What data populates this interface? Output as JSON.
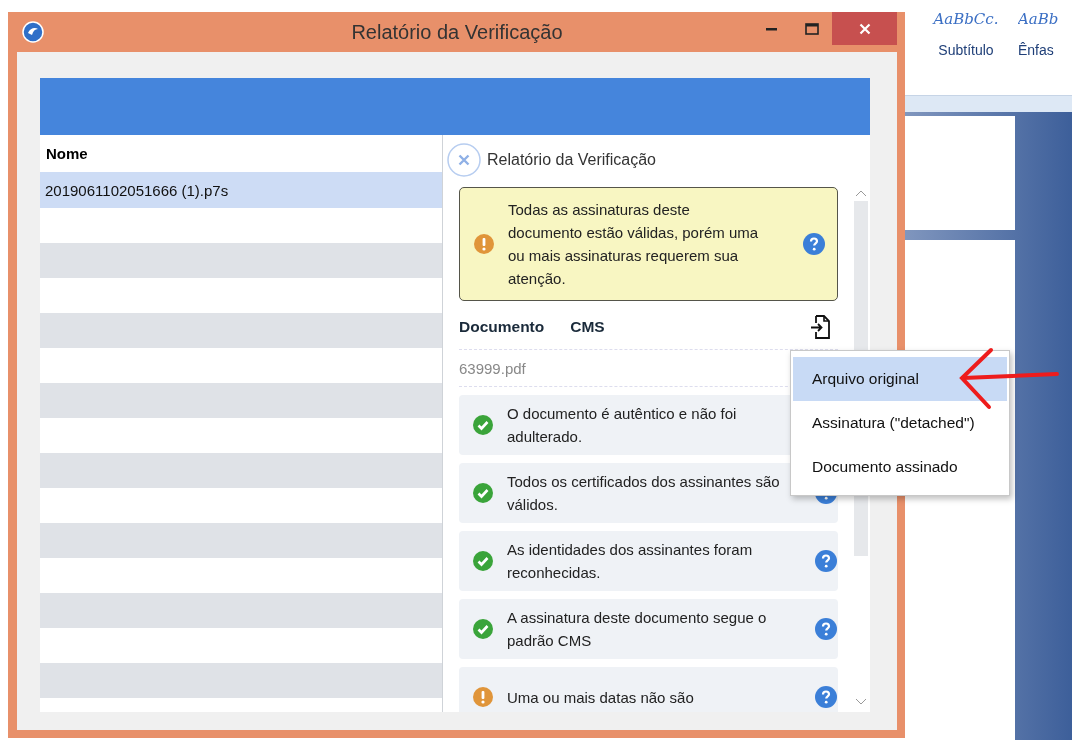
{
  "window": {
    "title": "Relatório da Verificação"
  },
  "file_list": {
    "column": "Nome",
    "rows": [
      {
        "name": "2019061102051666 (1).p7s",
        "selected": true
      }
    ]
  },
  "report": {
    "title": "Relatório da Verificação",
    "alert": {
      "kind": "warning",
      "text": "Todas as assinaturas deste documento estão válidas, porém uma ou mais assinaturas requerem sua atenção."
    },
    "sections": [
      {
        "label": "Documento"
      },
      {
        "label": "CMS"
      }
    ],
    "file": "63999.pdf",
    "checks": [
      {
        "kind": "ok",
        "text": "O documento é autêntico e não foi adulterado.",
        "help": false
      },
      {
        "kind": "ok",
        "text": "Todos os certificados dos assinantes são válidos.",
        "help": true
      },
      {
        "kind": "ok",
        "text": "As identidades dos assinantes foram reconhecidas.",
        "help": true
      },
      {
        "kind": "ok",
        "text": "A assinatura deste documento segue o padrão CMS",
        "help": true
      },
      {
        "kind": "warning",
        "text": "Uma ou mais datas não são",
        "help": true
      }
    ]
  },
  "export_menu": {
    "items": [
      {
        "label": "Arquivo original",
        "selected": true
      },
      {
        "label": "Assinatura (\"detached\")",
        "selected": false
      },
      {
        "label": "Documento assinado",
        "selected": false
      }
    ]
  },
  "background_app": {
    "styles": [
      {
        "sample": "AaBbCc.",
        "name": "Subtítulo"
      },
      {
        "sample": "AaBb",
        "name": "Ênfas"
      }
    ]
  }
}
